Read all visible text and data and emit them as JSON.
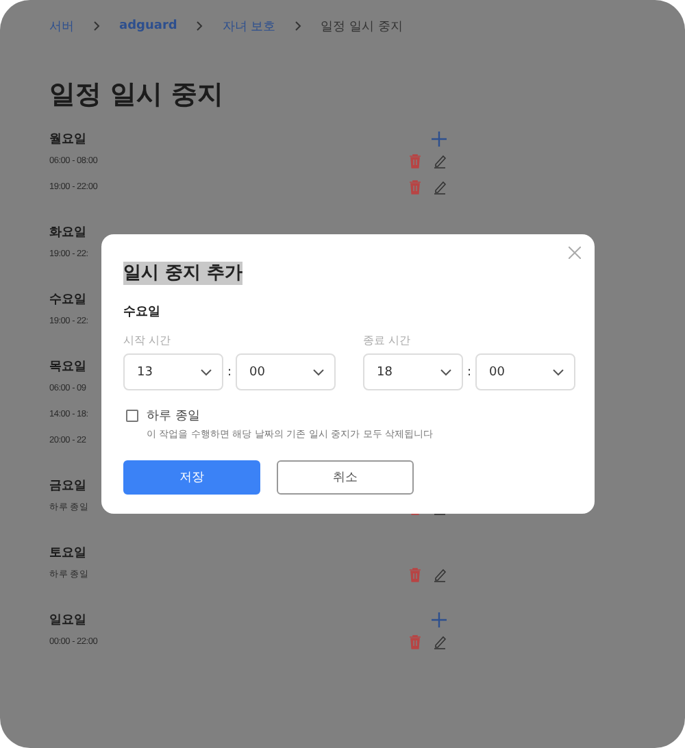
{
  "breadcrumb": [
    {
      "label": "서버",
      "current": false,
      "emphasized": false
    },
    {
      "label": "adguard",
      "current": false,
      "emphasized": true
    },
    {
      "label": "자녀 보호",
      "current": false,
      "emphasized": false
    },
    {
      "label": "일정 일시 중지",
      "current": true,
      "emphasized": false
    }
  ],
  "title": "일정 일시 중지",
  "days": [
    {
      "name": "월요일",
      "show_add": true,
      "entries": [
        {
          "time": "06:00 - 08:00",
          "show_actions": true
        },
        {
          "time": "19:00 - 22:00",
          "show_actions": true
        }
      ]
    },
    {
      "name": "화요일",
      "entries": [
        {
          "time": "19:00 - 22:"
        }
      ]
    },
    {
      "name": "수요일",
      "entries": [
        {
          "time": "19:00 - 22:"
        }
      ]
    },
    {
      "name": "목요일",
      "entries": [
        {
          "time": "06:00 - 09"
        },
        {
          "time": "14:00 - 18:"
        },
        {
          "time": "20:00 - 22"
        }
      ]
    },
    {
      "name": "금요일",
      "entries": [
        {
          "time": "하루 종일",
          "show_actions": true
        }
      ]
    },
    {
      "name": "토요일",
      "show_add": false,
      "entries": [
        {
          "time": "하루 종일",
          "show_actions": true
        }
      ]
    },
    {
      "name": "일요일",
      "show_add": true,
      "entries": [
        {
          "time": "00:00 - 22:00",
          "show_actions": true
        }
      ]
    }
  ],
  "dialog": {
    "title": "일시 중지 추가",
    "day": "수요일",
    "time_groups": [
      {
        "label": "시작 시간",
        "hour": "13",
        "separator": ":",
        "minute": "00"
      },
      {
        "label": "종료 시간",
        "hour": "18",
        "separator": ":",
        "minute": "00"
      }
    ],
    "all_day": {
      "label": "하루 종일",
      "checked": false,
      "note": "이 작업을 수행하면 해당 날짜의 기존 일시 중지가 모두 삭제됩니다"
    },
    "buttons": [
      {
        "label": "저장",
        "kind": "primary"
      },
      {
        "label": "취소",
        "kind": "secondary"
      }
    ]
  }
}
